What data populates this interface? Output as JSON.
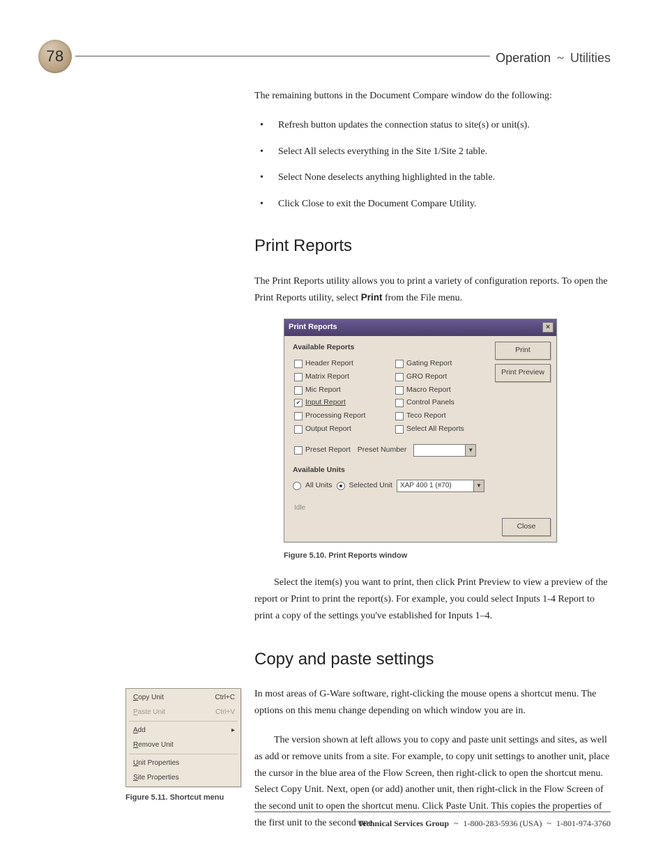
{
  "page_number": "78",
  "header": {
    "section": "Operation",
    "sep": "~",
    "subsection": "Utilities"
  },
  "intro": "The remaining buttons in the Document Compare window do the following:",
  "bullets": [
    "Refresh button updates the connection status to site(s) or unit(s).",
    "Select All selects everything in the Site 1/Site 2 table.",
    "Select None deselects anything highlighted in the table.",
    "Click Close to exit the Document Compare Utility."
  ],
  "print": {
    "heading": "Print Reports",
    "para_a": "The Print Reports utility allows you to print a variety of configuration reports. To open the Print Reports utility, select ",
    "para_bold": "Print",
    "para_b": " from the File menu.",
    "window": {
      "title": "Print Reports",
      "group_reports": "Available Reports",
      "left_items": [
        {
          "label": "Header Report",
          "checked": false
        },
        {
          "label": "Matrix Report",
          "checked": false
        },
        {
          "label": "Mic Report",
          "checked": false
        },
        {
          "label": "Input Report",
          "checked": true,
          "underline": true
        },
        {
          "label": "Processing Report",
          "checked": false
        },
        {
          "label": "Output Report",
          "checked": false
        }
      ],
      "right_items": [
        {
          "label": "Gating Report",
          "checked": false
        },
        {
          "label": "GRO Report",
          "checked": false
        },
        {
          "label": "Macro Report",
          "checked": false
        },
        {
          "label": "Control Panels",
          "checked": false
        },
        {
          "label": "Teco Report",
          "checked": false
        },
        {
          "label": "Select All Reports",
          "checked": false
        }
      ],
      "preset_chk": "Preset Report",
      "preset_label": "Preset Number",
      "preset_value": "",
      "group_units": "Available Units",
      "radio_all": "All Units",
      "radio_sel": "Selected Unit",
      "unit_value": "XAP 400 1 (#70)",
      "idle": "Idle",
      "btn_print": "Print",
      "btn_preview": "Print Preview",
      "btn_close": "Close"
    },
    "caption": "Figure 5.10. Print Reports window",
    "after": "Select the item(s) you want to print, then click Print Preview to view a preview of the report or Print to print the report(s). For example, you could select Inputs 1-4 Report to print a copy of the settings you've established for Inputs 1–4."
  },
  "copy": {
    "heading": "Copy and paste settings",
    "p1": "In most areas of G-Ware software, right-clicking the mouse opens a shortcut menu. The options on this menu change depending on which window you are in.",
    "p2": "The version shown at left allows you to copy and paste unit settings and sites, as well as add or remove units from a site. For example, to copy unit settings to another unit, place the cursor in the blue area of the Flow Screen, then right-click to open the shortcut menu. Select Copy Unit. Next, open (or add) another unit, then right-click in the Flow Screen of the second unit to open the shortcut menu. Click Paste Unit. This copies the properties of the first unit to the second one."
  },
  "shortcut_menu": {
    "items": [
      {
        "label": "Copy Unit",
        "shortcut": "Ctrl+C",
        "underline": "C"
      },
      {
        "label": "Paste Unit",
        "shortcut": "Ctrl+V",
        "disabled": true,
        "underline": "P"
      },
      {
        "divider": true
      },
      {
        "label": "Add",
        "submenu": true,
        "underline": "A"
      },
      {
        "label": "Remove Unit",
        "underline": "R"
      },
      {
        "divider": true
      },
      {
        "label": "Unit Properties",
        "underline": "U"
      },
      {
        "label": "Site Properties",
        "underline": "S"
      }
    ],
    "caption": "Figure 5.11. Shortcut menu"
  },
  "footer": {
    "group": "Technical Services Group",
    "sep": "~",
    "phone1": "1-800-283-5936 (USA)",
    "phone2": "1-801-974-3760"
  }
}
